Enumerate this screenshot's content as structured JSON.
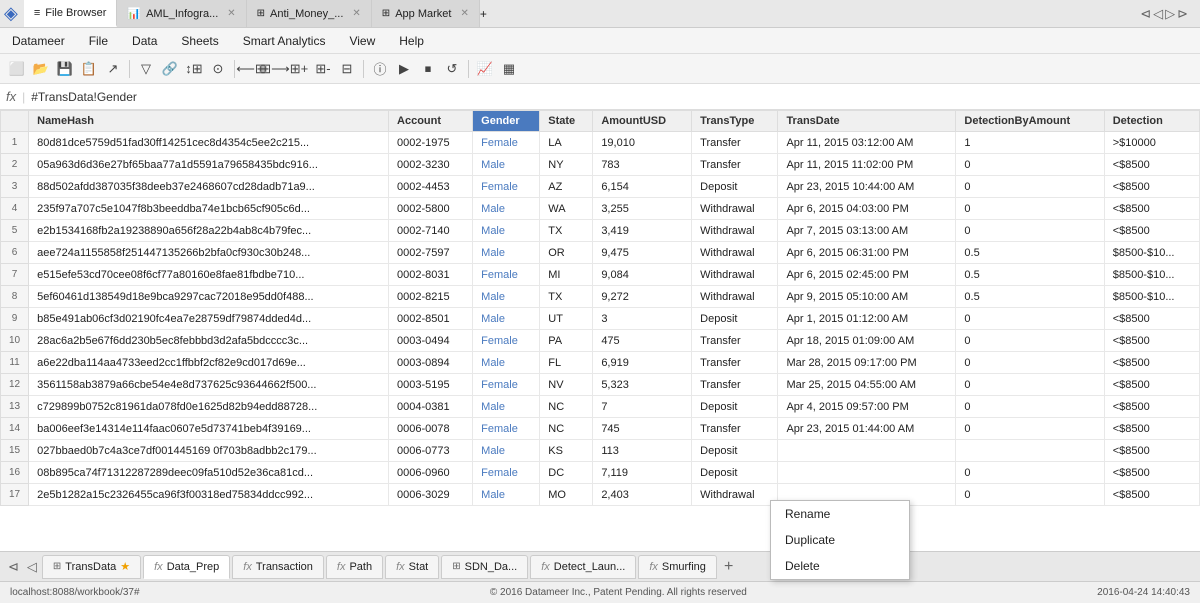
{
  "titleBar": {
    "logo": "◈",
    "tabs": [
      {
        "id": "file-browser",
        "label": "File Browser",
        "icon": "≡",
        "active": true,
        "closable": false
      },
      {
        "id": "aml-infogra",
        "label": "AML_Infogra...",
        "icon": "📊",
        "active": false,
        "closable": true
      },
      {
        "id": "anti-money",
        "label": "Anti_Money_...",
        "icon": "⊞",
        "active": false,
        "closable": true
      },
      {
        "id": "app-market",
        "label": "App Market",
        "icon": "⊞",
        "active": false,
        "closable": true
      }
    ],
    "navArrows": [
      "◀◀",
      "◀",
      "▶",
      "▶▶"
    ]
  },
  "menuBar": {
    "items": [
      "Datameer",
      "File",
      "Data",
      "Sheets",
      "Smart Analytics",
      "View",
      "Help"
    ]
  },
  "formulaBar": {
    "fxLabel": "fx",
    "cellRef": "=",
    "formula": "#TransData!Gender"
  },
  "columns": [
    {
      "id": "namehash",
      "label": "NameHash",
      "highlighted": false
    },
    {
      "id": "account",
      "label": "Account",
      "highlighted": false
    },
    {
      "id": "gender",
      "label": "Gender",
      "highlighted": true
    },
    {
      "id": "state",
      "label": "State",
      "highlighted": false
    },
    {
      "id": "amountusd",
      "label": "AmountUSD",
      "highlighted": false
    },
    {
      "id": "transtype",
      "label": "TransType",
      "highlighted": false
    },
    {
      "id": "transdate",
      "label": "TransDate",
      "highlighted": false
    },
    {
      "id": "detectionbyamount",
      "label": "DetectionByAmount",
      "highlighted": false
    },
    {
      "id": "detection",
      "label": "Detection",
      "highlighted": false
    }
  ],
  "rows": [
    {
      "num": 1,
      "namehash": "80d81dce5759d51fad30ff14251cec8d4354c5ee2c215...",
      "account": "0002-1975",
      "gender": "Female",
      "state": "LA",
      "amountusd": "19,010",
      "transtype": "Transfer",
      "transdate": "Apr 11, 2015 03:12:00 AM",
      "detectionbyamount": "1",
      "detection": ">$10000"
    },
    {
      "num": 2,
      "namehash": "05a963d6d36e27bf65baa77a1d5591a79658435bdc916...",
      "account": "0002-3230",
      "gender": "Male",
      "state": "NY",
      "amountusd": "783",
      "transtype": "Transfer",
      "transdate": "Apr 11, 2015 11:02:00 PM",
      "detectionbyamount": "0",
      "detection": "<$8500"
    },
    {
      "num": 3,
      "namehash": "88d502afdd387035f38deeb37e2468607cd28dadb71a9...",
      "account": "0002-4453",
      "gender": "Female",
      "state": "AZ",
      "amountusd": "6,154",
      "transtype": "Deposit",
      "transdate": "Apr 23, 2015 10:44:00 AM",
      "detectionbyamount": "0",
      "detection": "<$8500"
    },
    {
      "num": 4,
      "namehash": "235f97a707c5e1047f8b3beeddba74e1bcb65cf905c6d...",
      "account": "0002-5800",
      "gender": "Male",
      "state": "WA",
      "amountusd": "3,255",
      "transtype": "Withdrawal",
      "transdate": "Apr 6, 2015 04:03:00 PM",
      "detectionbyamount": "0",
      "detection": "<$8500"
    },
    {
      "num": 5,
      "namehash": "e2b1534168fb2a19238890a656f28a22b4ab8c4b79fec...",
      "account": "0002-7140",
      "gender": "Male",
      "state": "TX",
      "amountusd": "3,419",
      "transtype": "Withdrawal",
      "transdate": "Apr 7, 2015 03:13:00 AM",
      "detectionbyamount": "0",
      "detection": "<$8500"
    },
    {
      "num": 6,
      "namehash": "aee724a1155858f251447135266b2bfa0cf930c30b248...",
      "account": "0002-7597",
      "gender": "Male",
      "state": "OR",
      "amountusd": "9,475",
      "transtype": "Withdrawal",
      "transdate": "Apr 6, 2015 06:31:00 PM",
      "detectionbyamount": "0.5",
      "detection": "$8500-$10..."
    },
    {
      "num": 7,
      "namehash": "e515efe53cd70cee08f6cf77a80160e8fae81fbdbe710...",
      "account": "0002-8031",
      "gender": "Female",
      "state": "MI",
      "amountusd": "9,084",
      "transtype": "Withdrawal",
      "transdate": "Apr 6, 2015 02:45:00 PM",
      "detectionbyamount": "0.5",
      "detection": "$8500-$10..."
    },
    {
      "num": 8,
      "namehash": "5ef60461d138549d18e9bca9297cac72018e95dd0f488...",
      "account": "0002-8215",
      "gender": "Male",
      "state": "TX",
      "amountusd": "9,272",
      "transtype": "Withdrawal",
      "transdate": "Apr 9, 2015 05:10:00 AM",
      "detectionbyamount": "0.5",
      "detection": "$8500-$10..."
    },
    {
      "num": 9,
      "namehash": "b85e491ab06cf3d02190fc4ea7e28759df79874dded4d...",
      "account": "0002-8501",
      "gender": "Male",
      "state": "UT",
      "amountusd": "3",
      "transtype": "Deposit",
      "transdate": "Apr 1, 2015 01:12:00 AM",
      "detectionbyamount": "0",
      "detection": "<$8500"
    },
    {
      "num": 10,
      "namehash": "28ac6a2b5e67f6dd230b5ec8febbbd3d2afa5bdcccc3c...",
      "account": "0003-0494",
      "gender": "Female",
      "state": "PA",
      "amountusd": "475",
      "transtype": "Transfer",
      "transdate": "Apr 18, 2015 01:09:00 AM",
      "detectionbyamount": "0",
      "detection": "<$8500"
    },
    {
      "num": 11,
      "namehash": "a6e22dba114aa4733eed2cc1ffbbf2cf82e9cd017d69e...",
      "account": "0003-0894",
      "gender": "Male",
      "state": "FL",
      "amountusd": "6,919",
      "transtype": "Transfer",
      "transdate": "Mar 28, 2015 09:17:00 PM",
      "detectionbyamount": "0",
      "detection": "<$8500"
    },
    {
      "num": 12,
      "namehash": "3561158ab3879a66cbe54e4e8d737625c93644662f500...",
      "account": "0003-5195",
      "gender": "Female",
      "state": "NV",
      "amountusd": "5,323",
      "transtype": "Transfer",
      "transdate": "Mar 25, 2015 04:55:00 AM",
      "detectionbyamount": "0",
      "detection": "<$8500"
    },
    {
      "num": 13,
      "namehash": "c729899b0752c81961da078fd0e1625d82b94edd88728...",
      "account": "0004-0381",
      "gender": "Male",
      "state": "NC",
      "amountusd": "7",
      "transtype": "Deposit",
      "transdate": "Apr 4, 2015 09:57:00 PM",
      "detectionbyamount": "0",
      "detection": "<$8500"
    },
    {
      "num": 14,
      "namehash": "ba006eef3e14314e114faac0607e5d73741beb4f39169...",
      "account": "0006-0078",
      "gender": "Female",
      "state": "NC",
      "amountusd": "745",
      "transtype": "Transfer",
      "transdate": "Apr 23, 2015 01:44:00 AM",
      "detectionbyamount": "0",
      "detection": "<$8500"
    },
    {
      "num": 15,
      "namehash": "027bbaed0b7c4a3ce7df001445169 0f703b8adbb2c179...",
      "account": "0006-0773",
      "gender": "Male",
      "state": "KS",
      "amountusd": "113",
      "transtype": "Deposit",
      "transdate": "",
      "detectionbyamount": "",
      "detection": "<$8500"
    },
    {
      "num": 16,
      "namehash": "08b895ca74f71312287289deec09fa510d52e36ca81cd...",
      "account": "0006-0960",
      "gender": "Female",
      "state": "DC",
      "amountusd": "7,119",
      "transtype": "Deposit",
      "transdate": "",
      "detectionbyamount": "0",
      "detection": "<$8500"
    },
    {
      "num": 17,
      "namehash": "2e5b1282a15c2326455ca96f3f00318ed75834ddcc992...",
      "account": "0006-3029",
      "gender": "Male",
      "state": "MO",
      "amountusd": "2,403",
      "transtype": "Withdrawal",
      "transdate": "",
      "detectionbyamount": "0",
      "detection": "<$8500"
    }
  ],
  "contextMenu": {
    "items": [
      "Rename",
      "Duplicate",
      "Delete"
    ]
  },
  "bottomTabs": [
    {
      "id": "transdata",
      "label": "TransData",
      "icon": "table",
      "active": false,
      "star": true
    },
    {
      "id": "data-prep",
      "label": "Data_Prep",
      "icon": "fx",
      "active": true,
      "star": false
    },
    {
      "id": "transaction",
      "label": "Transaction",
      "icon": "fx",
      "active": false,
      "star": false
    },
    {
      "id": "path",
      "label": "Path",
      "icon": "fx",
      "active": false,
      "star": false
    },
    {
      "id": "stat",
      "label": "Stat",
      "icon": "fx",
      "active": false,
      "star": false
    },
    {
      "id": "sdn-data",
      "label": "SDN_Da...",
      "icon": "table",
      "active": false,
      "star": false
    },
    {
      "id": "detect-laun",
      "label": "Detect_Laun...",
      "icon": "fx",
      "active": false,
      "star": false
    },
    {
      "id": "smurfing",
      "label": "Smurfing",
      "icon": "fx",
      "active": false,
      "star": false
    }
  ],
  "statusBar": {
    "url": "localhost:8088/workbook/37#",
    "copyright": "© 2016 Datameer Inc., Patent Pending. All rights reserved",
    "datetime": "2016-04-24 14:40:43"
  }
}
